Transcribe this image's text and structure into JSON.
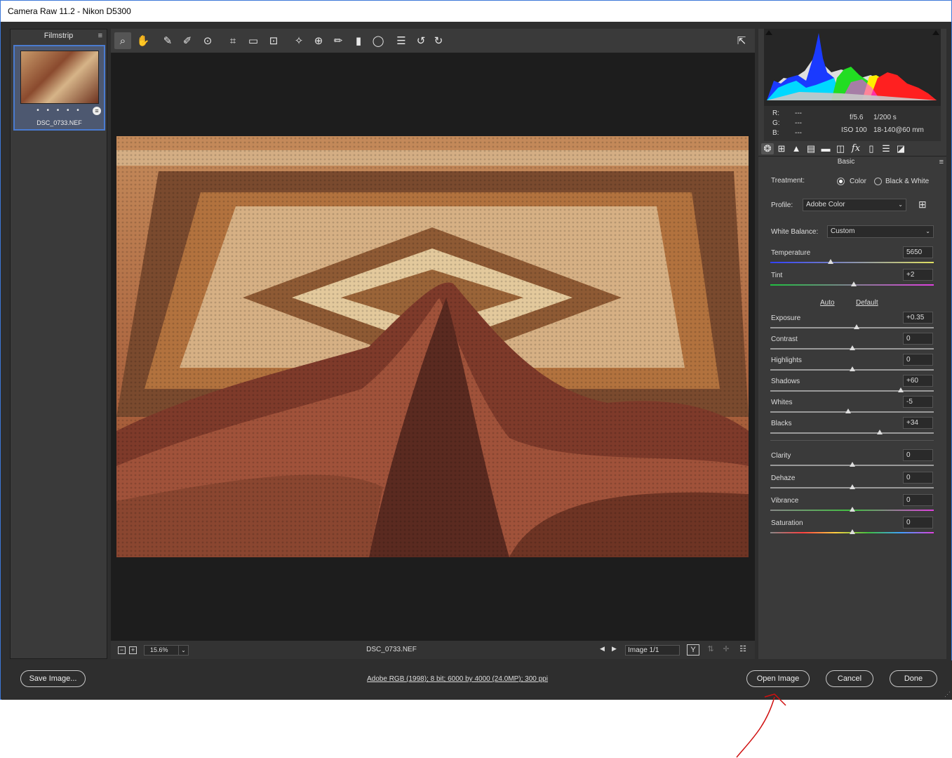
{
  "window": {
    "title": "Camera Raw 11.2  -  Nikon D5300"
  },
  "filmstrip": {
    "title": "Filmstrip",
    "thumb_rating": "• • • • •",
    "thumb_name": "DSC_0733.NEF"
  },
  "toolbar": {
    "tools": [
      "zoom-icon",
      "hand-icon",
      "white-balance-icon",
      "color-sampler-icon",
      "target-adjust-icon",
      "crop-icon",
      "straighten-icon",
      "transform-icon",
      "spot-removal-icon",
      "red-eye-icon",
      "adjustment-brush-icon",
      "graduated-filter-icon",
      "radial-filter-icon",
      "preferences-icon",
      "rotate-ccw-icon",
      "rotate-cw-icon",
      "fullscreen-icon"
    ]
  },
  "status": {
    "zoom": "15.6%",
    "filename": "DSC_0733.NEF",
    "image_count": "Image 1/1"
  },
  "exif": {
    "r_label": "R:",
    "g_label": "G:",
    "b_label": "B:",
    "r": "---",
    "g": "---",
    "b": "---",
    "aperture": "f/5.6",
    "shutter": "1/200 s",
    "iso": "ISO 100",
    "lens": "18-140@60 mm"
  },
  "basic": {
    "title": "Basic",
    "treatment_label": "Treatment:",
    "color_label": "Color",
    "bw_label": "Black & White",
    "profile_label": "Profile:",
    "profile_value": "Adobe Color",
    "wb_label": "White Balance:",
    "wb_value": "Custom",
    "auto_label": "Auto",
    "default_label": "Default",
    "sliders": [
      {
        "label": "Temperature",
        "value": "5650",
        "pos": 0.37
      },
      {
        "label": "Tint",
        "value": "+2",
        "pos": 0.51
      },
      {
        "label": "Exposure",
        "value": "+0.35",
        "pos": 0.53
      },
      {
        "label": "Contrast",
        "value": "0",
        "pos": 0.5
      },
      {
        "label": "Highlights",
        "value": "0",
        "pos": 0.5
      },
      {
        "label": "Shadows",
        "value": "+60",
        "pos": 0.8
      },
      {
        "label": "Whites",
        "value": "-5",
        "pos": 0.475
      },
      {
        "label": "Blacks",
        "value": "+34",
        "pos": 0.67
      },
      {
        "label": "Clarity",
        "value": "0",
        "pos": 0.5
      },
      {
        "label": "Dehaze",
        "value": "0",
        "pos": 0.5
      },
      {
        "label": "Vibrance",
        "value": "0",
        "pos": 0.5
      },
      {
        "label": "Saturation",
        "value": "0",
        "pos": 0.5
      }
    ]
  },
  "bottom": {
    "save_label": "Save Image...",
    "workflow_link": "Adobe RGB (1998); 8 bit; 6000 by 4000 (24.0MP); 300 ppi",
    "open_label": "Open Image",
    "cancel_label": "Cancel",
    "done_label": "Done"
  },
  "colors": {
    "accent": "#4a7bd0",
    "annotation": "#d01010"
  }
}
